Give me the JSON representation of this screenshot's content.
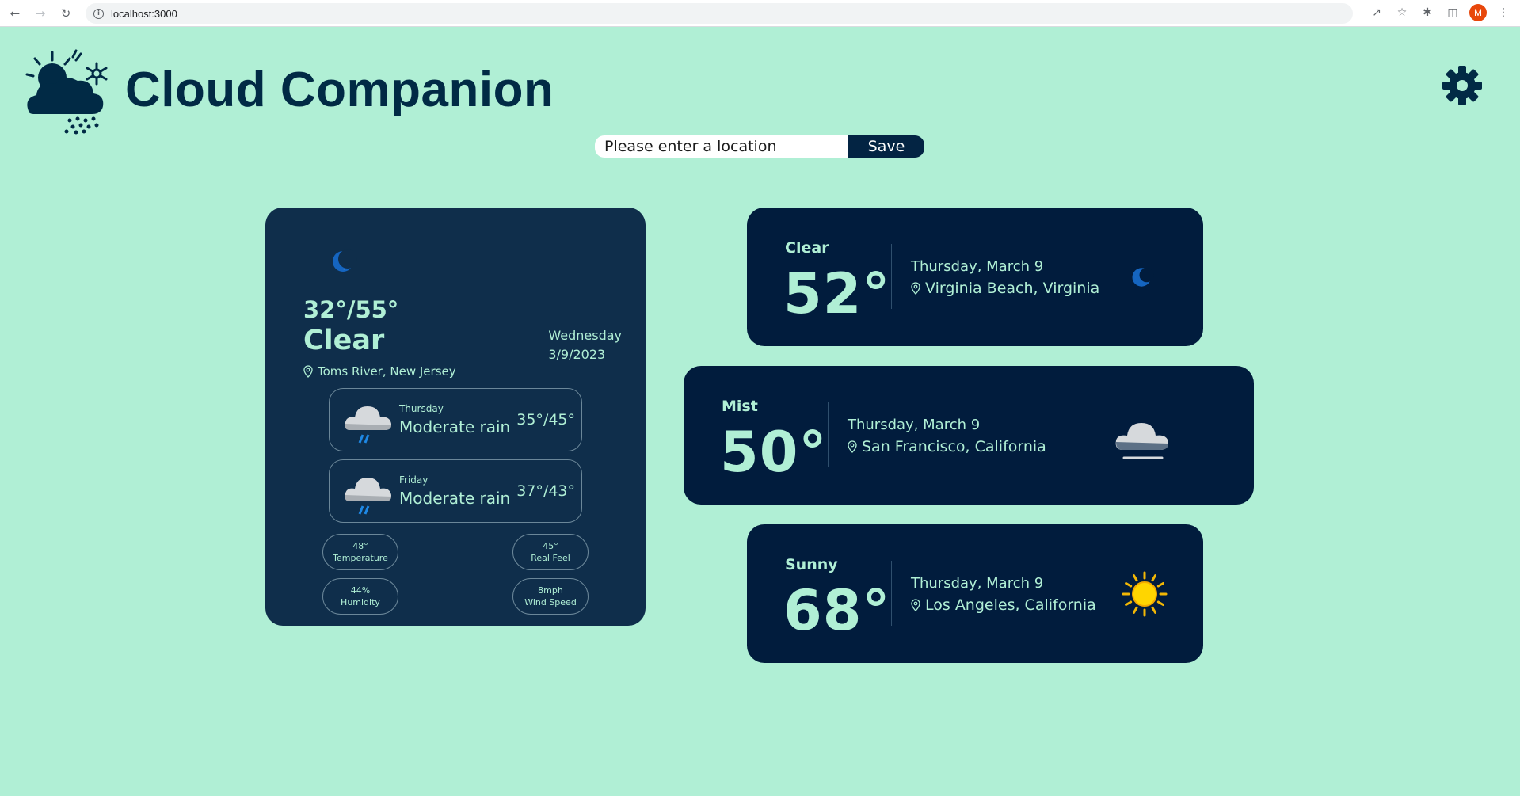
{
  "browser": {
    "url": "localhost:3000",
    "profile_initial": "M"
  },
  "header": {
    "title": "Cloud Companion"
  },
  "search": {
    "placeholder": "Please enter a location",
    "save_label": "Save"
  },
  "current": {
    "hi_lo": "32°/55°",
    "condition": "Clear",
    "location": "Toms River, New Jersey",
    "weekday": "Wednesday",
    "date": "3/9/2023",
    "icon": "moon-icon",
    "forecast": [
      {
        "day": "Thursday",
        "description": "Moderate rain",
        "temps": "35°/45°",
        "icon": "rain-cloud-icon"
      },
      {
        "day": "Friday",
        "description": "Moderate rain",
        "temps": "37°/43°",
        "icon": "rain-cloud-icon"
      }
    ],
    "stats": [
      {
        "value": "48°",
        "label": "Temperature"
      },
      {
        "value": "45°",
        "label": "Real Feel"
      },
      {
        "value": "44%",
        "label": "Humidity"
      },
      {
        "value": "8mph",
        "label": "Wind Speed"
      }
    ]
  },
  "cities": [
    {
      "condition": "Clear",
      "temp": "52°",
      "date": "Thursday, March 9",
      "location": "Virginia Beach, Virginia",
      "icon": "moon-icon"
    },
    {
      "condition": "Mist",
      "temp": "50°",
      "date": "Thursday, March 9",
      "location": "San Francisco, California",
      "icon": "mist-cloud-icon"
    },
    {
      "condition": "Sunny",
      "temp": "68°",
      "date": "Thursday, March 9",
      "location": "Los Angeles, California",
      "icon": "sun-icon"
    }
  ],
  "colors": {
    "background": "#b0efd5",
    "card_main": "#0f2e4b",
    "card_city": "#011c3d",
    "accent_text": "#b0efd5",
    "title": "#012a45"
  }
}
